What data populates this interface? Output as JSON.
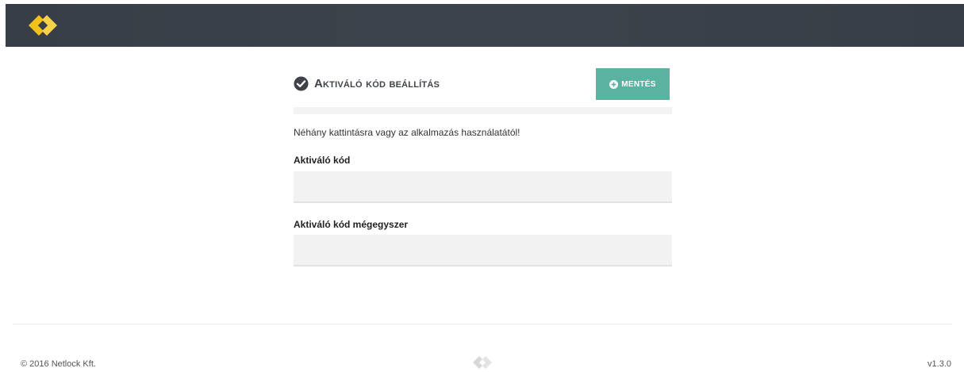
{
  "header": {
    "logo_icon": "netlock-diamond-logo-icon",
    "logo_color": "#f2c21b",
    "background_color": "#3a4049"
  },
  "form": {
    "title": "Aktiváló kód beállítás",
    "title_icon": "check-circle-icon",
    "save_label": "MENTÉS",
    "save_icon": "plus-circle-icon",
    "save_color": "#5ab2a0",
    "intro_text": "Néhány kattintásra vagy az alkalmazás használatától!",
    "fields": [
      {
        "label": "Aktiváló kód",
        "value": "",
        "placeholder": ""
      },
      {
        "label": "Aktiváló kód mégegyszer",
        "value": "",
        "placeholder": ""
      }
    ]
  },
  "footer": {
    "copyright": "© 2016 Netlock Kft.",
    "logo_icon": "netlock-diamond-logo-icon",
    "version": "v1.3.0"
  }
}
